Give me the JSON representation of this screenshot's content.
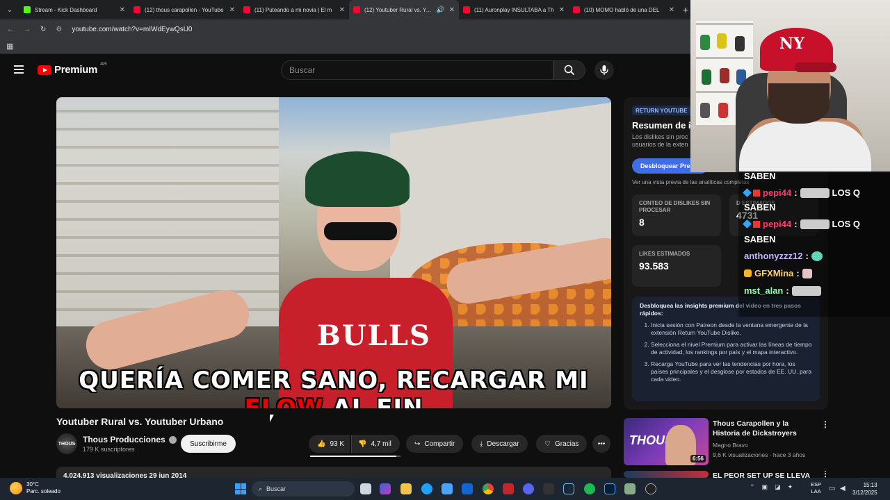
{
  "browser": {
    "tabs": [
      {
        "title": "Stream - Kick Dashboard",
        "favicon_color": "#53fc18"
      },
      {
        "title": "(12) thous carapollen - YouTube",
        "favicon_color": "#ff0033"
      },
      {
        "title": "(11) Puteando a mi novia | El m",
        "favicon_color": "#ff0033"
      },
      {
        "title": "(12) Youtuber Rural vs. Yout",
        "favicon_color": "#ff0033"
      },
      {
        "title": "(11) Auronplay INSULTABA a Th",
        "favicon_color": "#ff0033"
      },
      {
        "title": "(10) MOMO habló de una DEL",
        "favicon_color": "#ff0033"
      }
    ],
    "url": "youtube.com/watch?v=mIWdEywQsU0"
  },
  "youtube": {
    "logo_word": "Premium",
    "country_code": "AR",
    "search_placeholder": "Buscar"
  },
  "video": {
    "subtitle_white_1": "QUERÍA COMER SANO, RECARGAR MI ",
    "subtitle_red": "FLOW",
    "subtitle_white_2": " AL FIN",
    "jersey_text": "BULLS",
    "title": "Youtuber Rural vs. Youtuber Urbano",
    "channel": "Thous Producciones",
    "channel_avatar_text": "THOUS",
    "subscribers": "179 K suscriptores",
    "subscribe_label": "Suscribirme",
    "likes": "93 K",
    "dislikes": "4,7 mil",
    "like_ratio": 0.95,
    "share_label": "Compartir",
    "download_label": "Descargar",
    "thanks_label": "Gracias",
    "views_date": "4.024.913 visualizaciones  29 jun 2014"
  },
  "extension": {
    "badge": "RETURN YOUTUBE",
    "title": "Resumen de in",
    "desc": "Los dislikes sin proc usuarios de la exten",
    "unlock_button": "Desbloquear Pre",
    "preview_link": "Ver una vista previa de las analíticas completas",
    "stats": [
      {
        "label": "CONTEO DE DISLIKES SIN PROCESAR",
        "value": "8"
      },
      {
        "label": "D ESTIMADOS",
        "value": "4731"
      },
      {
        "label": "LIKES ESTIMADOS",
        "value": "93.583"
      }
    ],
    "insights_head": "Desbloquea las insights premium del video en tres pasos rápidos:",
    "insights_steps": [
      "Inicia sesión con Patreon desde la ventana emergente de la extensión Return YouTube Dislike.",
      "Selecciona el nivel Premium para activar las líneas de tiempo de actividad, los rankings por país y el mapa interactivo.",
      "Recarga YouTube para ver las tendencias por hora, los países principales y el desglose por estados de EE. UU. para cada video."
    ]
  },
  "recommendations": [
    {
      "title": "Thous Carapollen y la Historia de Dickstroyers",
      "channel": "Magno Bravo",
      "meta": "9,6 K visualizaciones · hace 3 años",
      "duration": "6:56",
      "thumb_text": "THOUS"
    },
    {
      "title": "EL PEOR SET UP SE LLEVA",
      "channel": "",
      "meta": "",
      "duration": "",
      "thumb_text": ""
    }
  ],
  "chat": {
    "lines": [
      {
        "user": "",
        "msg": "SABEN"
      },
      {
        "user": "pepi44",
        "msg": "LOS Q"
      },
      {
        "user": "",
        "msg": "SABEN"
      },
      {
        "user": "pepi44",
        "msg": "LOS Q"
      },
      {
        "user": "",
        "msg": "SABEN"
      },
      {
        "user": "anthonyzzz12",
        "msg": ""
      },
      {
        "user": "GFXMina",
        "msg": ""
      },
      {
        "user": "mst_alan",
        "msg": ""
      }
    ]
  },
  "taskbar": {
    "temperature": "30°C",
    "weather": "Parc. soleado",
    "search_label": "Buscar",
    "lang_1": "ESP",
    "lang_2": "LAA",
    "time": "15:13",
    "date": "3/12/2025"
  }
}
